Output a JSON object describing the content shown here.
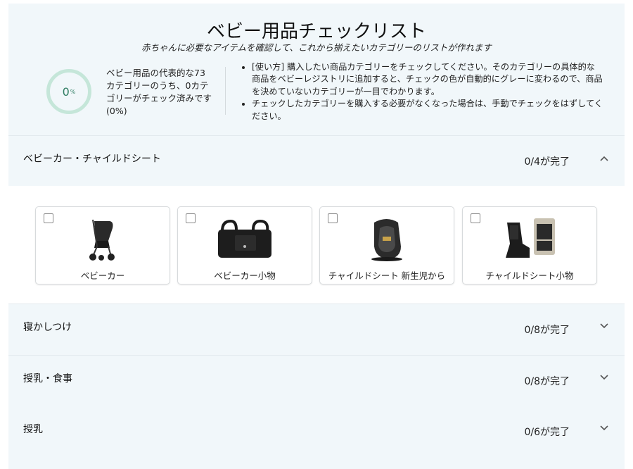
{
  "header": {
    "title": "ベビー用品チェックリスト",
    "subtitle": "赤ちゃんに必要なアイテムを確認して、これから揃えたいカテゴリーのリストが作れます",
    "progress": {
      "value": "0",
      "unit": "%",
      "fraction": 0
    },
    "summary": "ベビー用品の代表的な73カテゴリーのうち、0カテゴリーがチェック済みです(0%)",
    "notes": [
      "[使い方] 購入したい商品カテゴリーをチェックしてください。そのカテゴリーの具体的な商品をベビーレジストリに追加すると、チェックの色が自動的にグレーに変わるので、商品を決めていないカテゴリーが一目でわかります。",
      "チェックしたカテゴリーを購入する必要がなくなった場合は、手動でチェックをはずしてください。"
    ]
  },
  "sections": [
    {
      "label": "ベビーカー・チャイルドシート",
      "count": "0/4が完了",
      "expanded": true,
      "items": [
        {
          "name": "ベビーカー",
          "checked": false,
          "icon": "stroller-image"
        },
        {
          "name": "ベビーカー小物",
          "checked": false,
          "icon": "stroller-bag-image"
        },
        {
          "name": "チャイルドシート 新生児から",
          "checked": false,
          "icon": "car-seat-image"
        },
        {
          "name": "チャイルドシート小物",
          "checked": false,
          "icon": "car-seat-protector-image"
        }
      ]
    },
    {
      "label": "寝かしつけ",
      "count": "0/8が完了",
      "expanded": false
    },
    {
      "label": "授乳・食事",
      "count": "0/8が完了",
      "expanded": false
    },
    {
      "label": "授乳",
      "count": "0/6が完了",
      "expanded": false
    }
  ],
  "colors": {
    "panel_bg": "#f1f7fa",
    "ring": "#c5e6d9",
    "ring_text": "#2f7d62",
    "border": "#d7dadc"
  }
}
